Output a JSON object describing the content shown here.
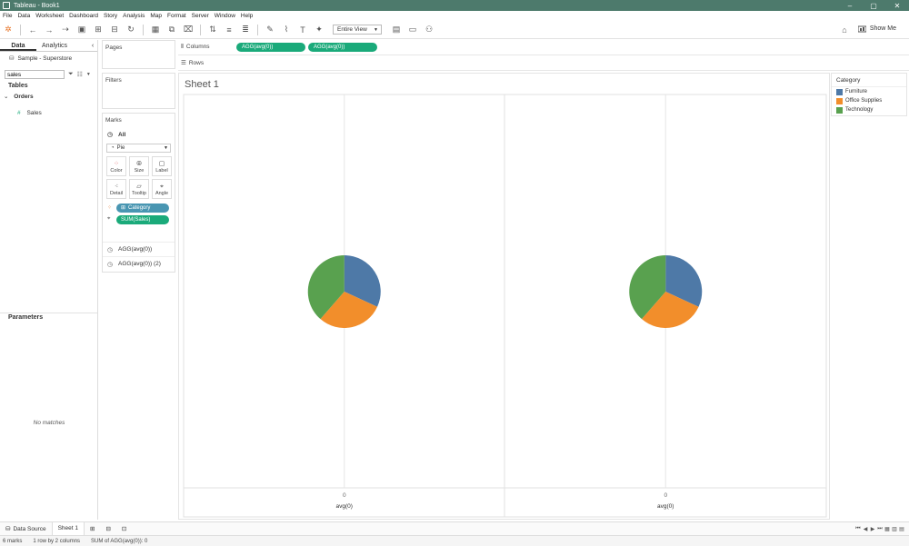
{
  "window": {
    "title": "Tableau - Book1"
  },
  "menu": [
    "File",
    "Data",
    "Worksheet",
    "Dashboard",
    "Story",
    "Analysis",
    "Map",
    "Format",
    "Server",
    "Window",
    "Help"
  ],
  "toolbar": {
    "view_mode": "Entire View",
    "show_me": "Show Me"
  },
  "left_pane": {
    "tabs": [
      "Data",
      "Analytics"
    ],
    "datasource": "Sample - Superstore",
    "search_value": "sales",
    "tables_heading": "Tables",
    "table_name": "Orders",
    "field_name": "Sales",
    "parameters_heading": "Parameters",
    "no_matches": "No matches"
  },
  "cards": {
    "pages": "Pages",
    "filters": "Filters",
    "marks": "Marks",
    "marks_all": "All",
    "mark_type": "Pie",
    "buttons": [
      "Color",
      "Size",
      "Label",
      "Detail",
      "Tooltip",
      "Angle"
    ],
    "pill_category": "Category",
    "pill_sales": "SUM(Sales)",
    "agg1": "AGG(avg(0))",
    "agg2": "AGG(avg(0)) (2)"
  },
  "shelves": {
    "columns_label": "Columns",
    "rows_label": "Rows",
    "column_pills": [
      "AGG(avg(0))",
      "AGG(avg(0))"
    ]
  },
  "sheet": {
    "title": "Sheet 1"
  },
  "chart_data": [
    {
      "type": "pie",
      "categories": [
        "Furniture",
        "Office Supplies",
        "Technology"
      ],
      "values": [
        0.319,
        0.295,
        0.386
      ],
      "colors": [
        "#4e79a7",
        "#f28e2b",
        "#59a14f"
      ],
      "tick_label": "0",
      "xlabel": "avg(0)"
    },
    {
      "type": "pie",
      "categories": [
        "Furniture",
        "Office Supplies",
        "Technology"
      ],
      "values": [
        0.319,
        0.295,
        0.386
      ],
      "colors": [
        "#4e79a7",
        "#f28e2b",
        "#59a14f"
      ],
      "tick_label": "0",
      "xlabel": "avg(0)"
    }
  ],
  "legend": {
    "title": "Category",
    "items": [
      {
        "label": "Furniture",
        "color": "#4e79a7"
      },
      {
        "label": "Office Supplies",
        "color": "#f28e2b"
      },
      {
        "label": "Technology",
        "color": "#59a14f"
      }
    ]
  },
  "bottom_tabs": {
    "data_source": "Data Source",
    "sheet": "Sheet 1"
  },
  "status": {
    "marks": "6 marks",
    "rows_cols": "1 row by 2 columns",
    "sum": "SUM of AGG(avg(0)): 0"
  }
}
